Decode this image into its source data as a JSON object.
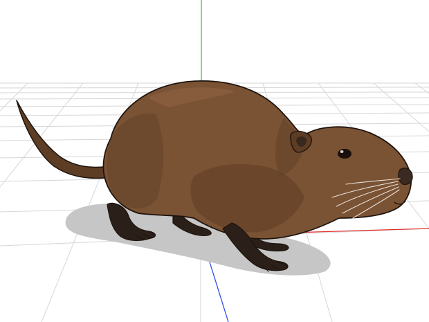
{
  "viewport": {
    "background": "#ffffff",
    "grid_color": "#d6d6d6",
    "axes": {
      "x_color": "#e03030",
      "y_color": "#2ecc2e",
      "z_color": "#3050e8"
    }
  },
  "model": {
    "subject": "rodent",
    "fur_color": "#7a5234",
    "fur_shadow_color": "#5e3d25",
    "fur_highlight_color": "#8e6442",
    "paw_color": "#2a2019",
    "eye_color": "#1a0f0a",
    "nose_color": "#3a2a22",
    "whisker_color": "#e8e0d8",
    "shadow_color": "#c6c6c6",
    "outline_color": "#1e140e"
  }
}
